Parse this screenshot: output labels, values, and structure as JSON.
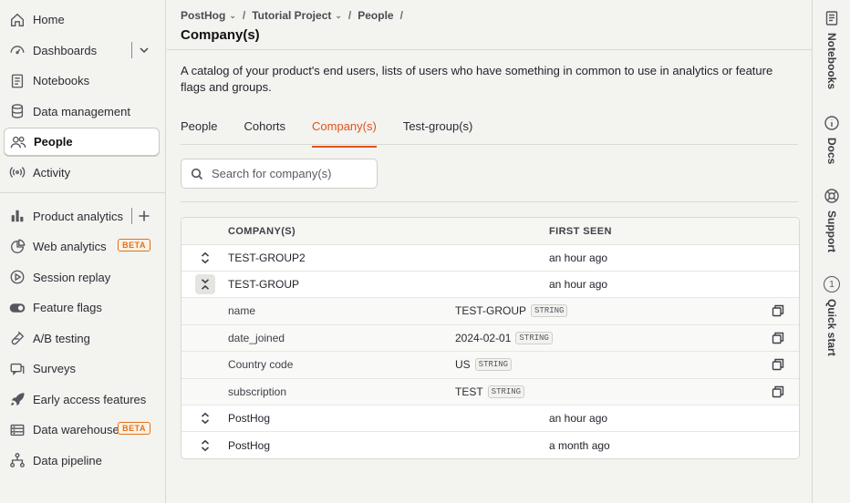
{
  "sidebar": {
    "items": [
      {
        "label": "Home",
        "icon": "home-icon"
      },
      {
        "label": "Dashboards",
        "icon": "dashboard-icon"
      },
      {
        "label": "Notebooks",
        "icon": "notebook-icon"
      },
      {
        "label": "Data management",
        "icon": "database-icon"
      },
      {
        "label": "People",
        "icon": "people-icon"
      },
      {
        "label": "Activity",
        "icon": "activity-icon"
      },
      {
        "label": "Product analytics",
        "icon": "bar-chart-icon"
      },
      {
        "label": "Web analytics",
        "icon": "pie-chart-icon",
        "badge": "BETA"
      },
      {
        "label": "Session replay",
        "icon": "play-icon"
      },
      {
        "label": "Feature flags",
        "icon": "toggle-icon"
      },
      {
        "label": "A/B testing",
        "icon": "flask-icon"
      },
      {
        "label": "Surveys",
        "icon": "chat-icon"
      },
      {
        "label": "Early access features",
        "icon": "rocket-icon"
      },
      {
        "label": "Data warehouse",
        "icon": "server-icon",
        "badge": "BETA"
      },
      {
        "label": "Data pipeline",
        "icon": "pipeline-icon"
      }
    ]
  },
  "breadcrumb": {
    "org": "PostHog",
    "project": "Tutorial Project",
    "section": "People",
    "sep": "/"
  },
  "page": {
    "title": "Company(s)",
    "description": "A catalog of your product's end users, lists of users who have something in common to use in analytics or feature flags and groups."
  },
  "tabs": [
    {
      "label": "People"
    },
    {
      "label": "Cohorts"
    },
    {
      "label": "Company(s)",
      "active": true
    },
    {
      "label": "Test-group(s)"
    }
  ],
  "search": {
    "placeholder": "Search for company(s)"
  },
  "table": {
    "headers": {
      "name": "COMPANY(S)",
      "seen": "FIRST SEEN"
    },
    "rows": [
      {
        "name": "TEST-GROUP2",
        "seen": "an hour ago"
      },
      {
        "name": "TEST-GROUP",
        "seen": "an hour ago",
        "expanded": true,
        "properties": [
          {
            "key": "name",
            "value": "TEST-GROUP",
            "type": "STRING"
          },
          {
            "key": "date_joined",
            "value": "2024-02-01",
            "type": "STRING"
          },
          {
            "key": "Country code",
            "value": "US",
            "type": "STRING"
          },
          {
            "key": "subscription",
            "value": "TEST",
            "type": "STRING"
          }
        ]
      },
      {
        "name": "PostHog",
        "seen": "an hour ago"
      },
      {
        "name": "PostHog",
        "seen": "a month ago"
      }
    ]
  },
  "rightbar": {
    "items": [
      {
        "label": "Notebooks",
        "icon": "notebook-icon"
      },
      {
        "label": "Docs",
        "icon": "info-icon"
      },
      {
        "label": "Support",
        "icon": "lifebuoy-icon"
      },
      {
        "label": "Quick start",
        "icon": "quickstart-icon",
        "number": "1"
      }
    ]
  },
  "colors": {
    "accent": "#e0521c",
    "beta": "#e0721b"
  }
}
